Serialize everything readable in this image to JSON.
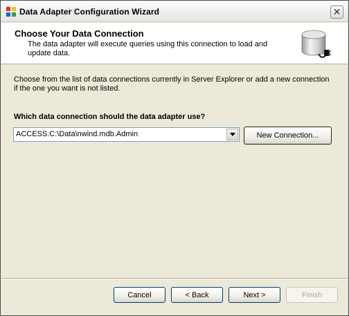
{
  "window": {
    "title": "Data Adapter Configuration Wizard",
    "close_symbol": "✕"
  },
  "header": {
    "title": "Choose Your Data Connection",
    "description": "The data adapter will execute queries using this connection to load and update data.",
    "icon": "database-plug-icon"
  },
  "main": {
    "instructions": "Choose from the list of data connections currently in Server Explorer or add a new connection if the one you want is not listed.",
    "question": "Which data connection should the data adapter use?",
    "connection_select": {
      "selected_value": "ACCESS.C:\\Data\\nwind.mdb.Admin"
    },
    "new_connection_label": "New Connection..."
  },
  "footer": {
    "cancel_label": "Cancel",
    "back_label": "< Back",
    "next_label": "Next >",
    "finish_label": "Finish",
    "finish_enabled": false
  },
  "colors": {
    "window_bg": "#ece9d8",
    "border_blue": "#003c74",
    "disabled_text": "#aca899"
  }
}
